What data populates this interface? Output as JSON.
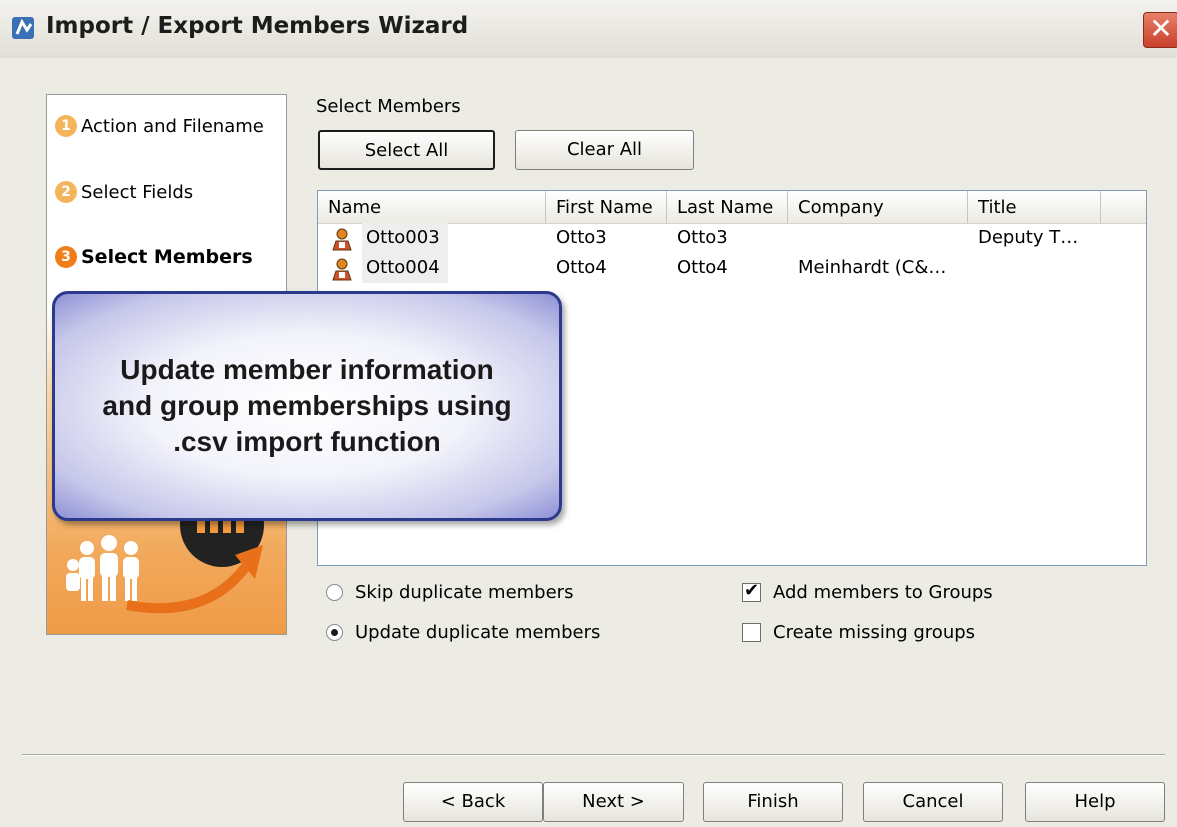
{
  "window": {
    "title": "Import / Export Members Wizard",
    "close_glyph": "✕"
  },
  "steps": [
    {
      "number": "1",
      "label": "Action and Filename",
      "state": "done"
    },
    {
      "number": "2",
      "label": "Select Fields",
      "state": "done"
    },
    {
      "number": "3",
      "label": "Select Members",
      "state": "active"
    }
  ],
  "select_members": {
    "heading": "Select Members",
    "select_all_label": "Select All",
    "clear_all_label": "Clear All"
  },
  "list": {
    "columns": [
      "Name",
      "First Name",
      "Last Name",
      "Company",
      "Title"
    ],
    "rows": [
      {
        "name": "Otto003",
        "first_name": "Otto3",
        "last_name": "Otto3",
        "company": "",
        "title": "Deputy T…"
      },
      {
        "name": "Otto004",
        "first_name": "Otto4",
        "last_name": "Otto4",
        "company": "Meinhardt (C&…",
        "title": ""
      }
    ]
  },
  "options": {
    "skip_duplicates": {
      "label": "Skip duplicate members",
      "selected": false
    },
    "update_duplicates": {
      "label": "Update duplicate members",
      "selected": true
    },
    "add_to_groups": {
      "label": "Add members to Groups",
      "checked": true
    },
    "create_missing_groups": {
      "label": "Create missing groups",
      "checked": false
    }
  },
  "footer": {
    "back_label": "< Back",
    "next_label": "Next >",
    "finish_label": "Finish",
    "cancel_label": "Cancel",
    "help_label": "Help"
  },
  "callout": {
    "text": "Update member information\nand group memberships using\n.csv import function"
  },
  "colors": {
    "accent_orange": "#f07d1a",
    "callout_border": "#2c3a8e",
    "close_red": "#c8402b"
  },
  "icons": {
    "app": "app-icon",
    "member": "member-icon",
    "people": "people-group-icon",
    "arrow": "curved-arrow-icon"
  }
}
